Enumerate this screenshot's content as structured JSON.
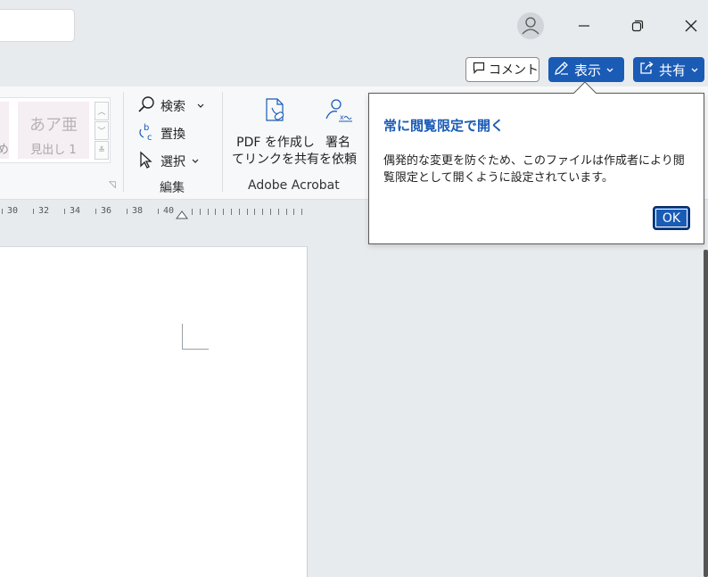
{
  "title_bar": {
    "search_value": ""
  },
  "header_buttons": {
    "comment_label": "コメント",
    "view_label": "表示",
    "share_label": "共有"
  },
  "ribbon": {
    "styles": {
      "prev_text": "め",
      "sample_text": "あア亜",
      "style_name": "見出し 1"
    },
    "editing": {
      "find_label": "検索",
      "replace_label": "置換",
      "select_label": "選択",
      "group_label": "編集"
    },
    "acrobat": {
      "create_pdf_line1": "PDF を作成し",
      "create_pdf_line2": "てリンクを共有",
      "sign_line1": "署名",
      "sign_line2": "を依頼",
      "group_label": "Adobe Acrobat"
    }
  },
  "ruler": {
    "numbers": [
      "30",
      "32",
      "34",
      "36",
      "38",
      "40"
    ]
  },
  "callout": {
    "title": "常に閲覧限定で開く",
    "body": "偶発的な変更を防ぐため、このファイルは作成者により閲覧限定として開くように設定されています。",
    "ok_label": "OK"
  },
  "colors": {
    "accent": "#1a5bb5",
    "background": "#e8ebee"
  },
  "icons": [
    "avatar-icon",
    "minimize-icon",
    "restore-icon",
    "close-icon",
    "comment-icon",
    "pen-icon",
    "share-icon",
    "search-icon",
    "replace-icon",
    "select-icon",
    "pdf-link-icon",
    "signature-icon"
  ]
}
